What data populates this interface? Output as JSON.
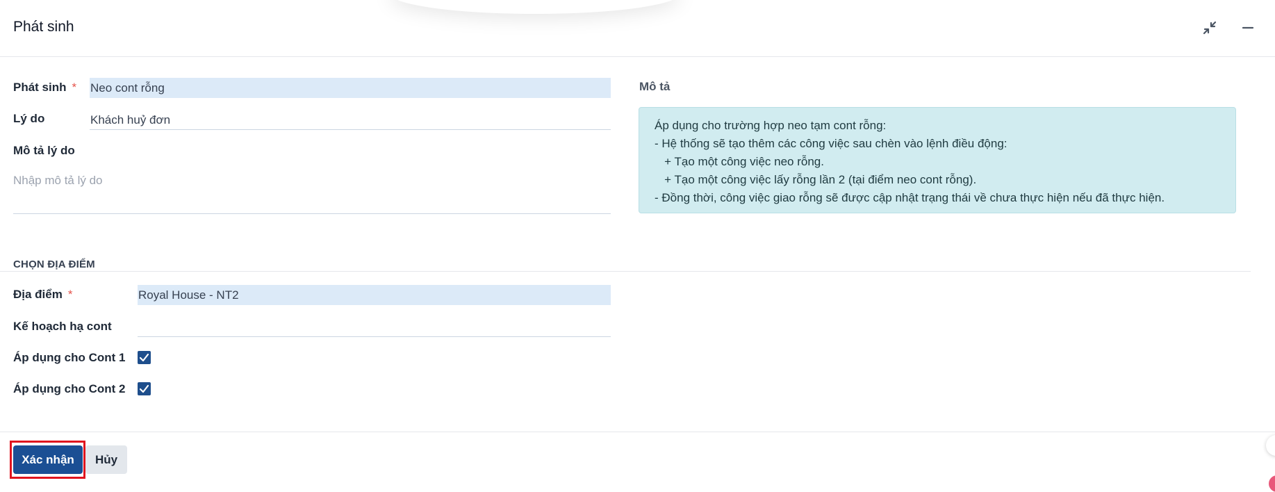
{
  "dialog": {
    "title": "Phát sinh"
  },
  "form": {
    "phat_sinh": {
      "label": "Phát sinh",
      "required": "*",
      "value": "Neo cont rỗng"
    },
    "ly_do": {
      "label": "Lý do",
      "value": "Khách huỷ đơn"
    },
    "mo_ta_ly_do": {
      "label": "Mô tả lý do",
      "placeholder": "Nhập mô tả lý do"
    }
  },
  "description": {
    "label": "Mô tả",
    "lines": [
      "Áp dụng cho trường hợp neo tạm cont rỗng:",
      "- Hệ thống sẽ tạo thêm các công việc sau chèn vào lệnh điều động:",
      "   + Tạo một công việc neo rỗng.",
      "   + Tạo một công việc lấy rỗng lần 2 (tại điểm neo cont rỗng).",
      "- Đồng thời, công việc giao rỗng sẽ được cập nhật trạng thái về chưa thực hiện nếu đã thực hiện."
    ]
  },
  "location_section": {
    "title": "CHỌN ĐỊA ĐIỂM",
    "dia_diem": {
      "label": "Địa điểm",
      "required": "*",
      "value": "Royal House - NT2"
    },
    "ke_hoach": {
      "label": "Kế hoạch hạ cont",
      "value": ""
    },
    "cont1": {
      "label": "Áp dụng cho Cont 1",
      "checked": true
    },
    "cont2": {
      "label": "Áp dụng cho Cont 2",
      "checked": true
    }
  },
  "footer": {
    "confirm_label": "Xác nhận",
    "cancel_label": "Hủy"
  },
  "colors": {
    "primary": "#1b4f94",
    "highlight_input": "#dceaf8",
    "info_box": "#d1ecf0",
    "required": "#e5534b",
    "focus_outline": "#e0141e"
  }
}
